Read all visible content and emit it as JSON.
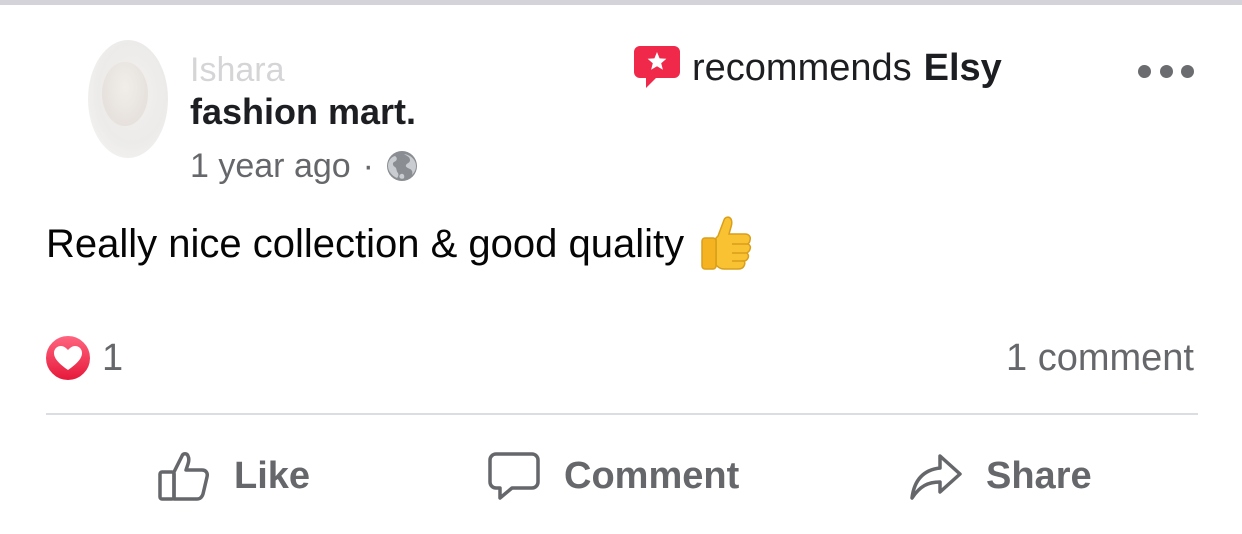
{
  "post": {
    "author_name": "Ishara",
    "recommend_text": "recommends",
    "recommended_page": "Elsy",
    "page_name": "fashion mart.",
    "timestamp": "1 year ago",
    "separator": "·",
    "privacy_icon": "globe-icon",
    "body": "Really nice collection & good quality",
    "body_emoji": "thumbs-up-emoji",
    "reaction_icon": "love-reaction-icon",
    "reaction_count": "1",
    "comment_count_text": "1 comment"
  },
  "actions": {
    "like_label": "Like",
    "comment_label": "Comment",
    "share_label": "Share"
  },
  "colors": {
    "recommend_accent": "#f02849",
    "love_reaction": "#f33e58",
    "secondary_text": "#65676b",
    "primary_text": "#1c1e21",
    "divider": "#dadde1"
  }
}
